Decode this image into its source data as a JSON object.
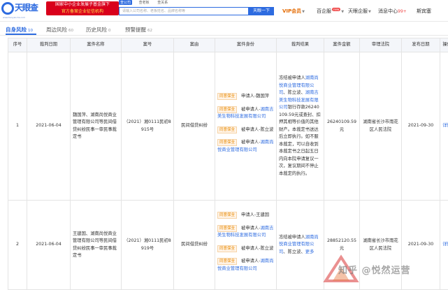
{
  "header": {
    "logo_text": "天眼查",
    "logo_text2": "TianYanCha",
    "logo_sub": "www.tianyancha.com",
    "banner_line1": "国家中小企业发展子基金旗下",
    "banner_line2": "官方备案企业征信机构",
    "search_tabs": [
      "查公司",
      "查老板",
      "查关系"
    ],
    "search_placeholder": "请输入公司名称、老板姓名、品牌名称等",
    "search_button": "天眼一下",
    "nav": {
      "vip": "VIP会员",
      "vip_badge": "hot",
      "enterprise_service": "百企服",
      "enterprise_badge": "new",
      "tianyan_enterprise": "天眼企服",
      "messages": "消息中心",
      "message_count": "99+",
      "user": "斯宾塞"
    }
  },
  "tabs": [
    {
      "label": "自身风险",
      "count": "10"
    },
    {
      "label": "周边风险",
      "count": "60"
    },
    {
      "label": "历史风险",
      "count": "0"
    },
    {
      "label": "预警提醒",
      "count": "62"
    }
  ],
  "table": {
    "headers": [
      "序号",
      "裁判日期",
      "案件名称",
      "案号",
      "案由",
      "案件身份",
      "裁判结果",
      "案件金额",
      "审理法院",
      "发布日期",
      "操作"
    ],
    "rows": [
      {
        "index": "1",
        "date": "2021-06-04",
        "case_name": "魏国萍、湖南尚悦商业管理有限公司等民间借贷纠纷民事一审民事裁定书",
        "case_no": "（2021）湘0111民初8915号",
        "cause": "民间借贷纠纷",
        "parties": [
          {
            "tag": "同意保全",
            "role": "申请人-魏国萍",
            "party_link": ""
          },
          {
            "tag": "同意保全",
            "role": "被申请人-",
            "party_link": "湖南吉美生物科技发展有限公司"
          },
          {
            "tag": "同意保全",
            "role": "被申请人-陈立波",
            "party_link": ""
          },
          {
            "tag": "同意保全",
            "role": "被申请人-",
            "party_link": "湖南尚悦商业管理有限公司"
          }
        ],
        "result_pre": "冻结被申请人",
        "result_link1": "湖南尚悦商业管理有限公司",
        "result_mid1": "、陈立波、",
        "result_link2": "湖南吉美生物科技发展有限公司",
        "result_post": "银行存款26240109.59元或查封、扣押其相等价值的其他财产。本裁定书送达后立即执行。如不服本裁定，可以自收到本裁定书之日起五日内向本院申请复议一次，复议期间不停止本裁定的执行。",
        "amount": "26240109.59元",
        "court": "湖南省长沙市雨花区人民法院",
        "publish_date": "2021-09-30",
        "action": "详情"
      },
      {
        "index": "2",
        "date": "2021-06-04",
        "case_name": "王建国、湖南尚悦商业管理有限公司等民间借贷纠纷民事一审民事裁定书",
        "case_no": "（2021）湘0111民初8919号",
        "cause": "民间借贷纠纷",
        "parties": [
          {
            "tag": "同意保全",
            "role": "申请人-王建国",
            "party_link": ""
          },
          {
            "tag": "同意保全",
            "role": "被申请人-",
            "party_link": "湖南吉美生物科技发展有限公司"
          },
          {
            "tag": "同意保全",
            "role": "被申请人-陈立波",
            "party_link": ""
          },
          {
            "tag": "同意保全",
            "role": "被申请人-",
            "party_link": "湖南尚悦商业管理有限公司"
          }
        ],
        "result_pre": "冻结被申请人",
        "result_link1": "湖南尚悦商业管理有限公司",
        "result_mid1": "、陈立波、",
        "result_link2": "更多",
        "amount": "28852120.55元",
        "court": "湖南省长沙市雨花区人民法院",
        "publish_date": "2021-09-30",
        "action": "详情"
      }
    ]
  },
  "watermark": "知乎 @悦然运营"
}
